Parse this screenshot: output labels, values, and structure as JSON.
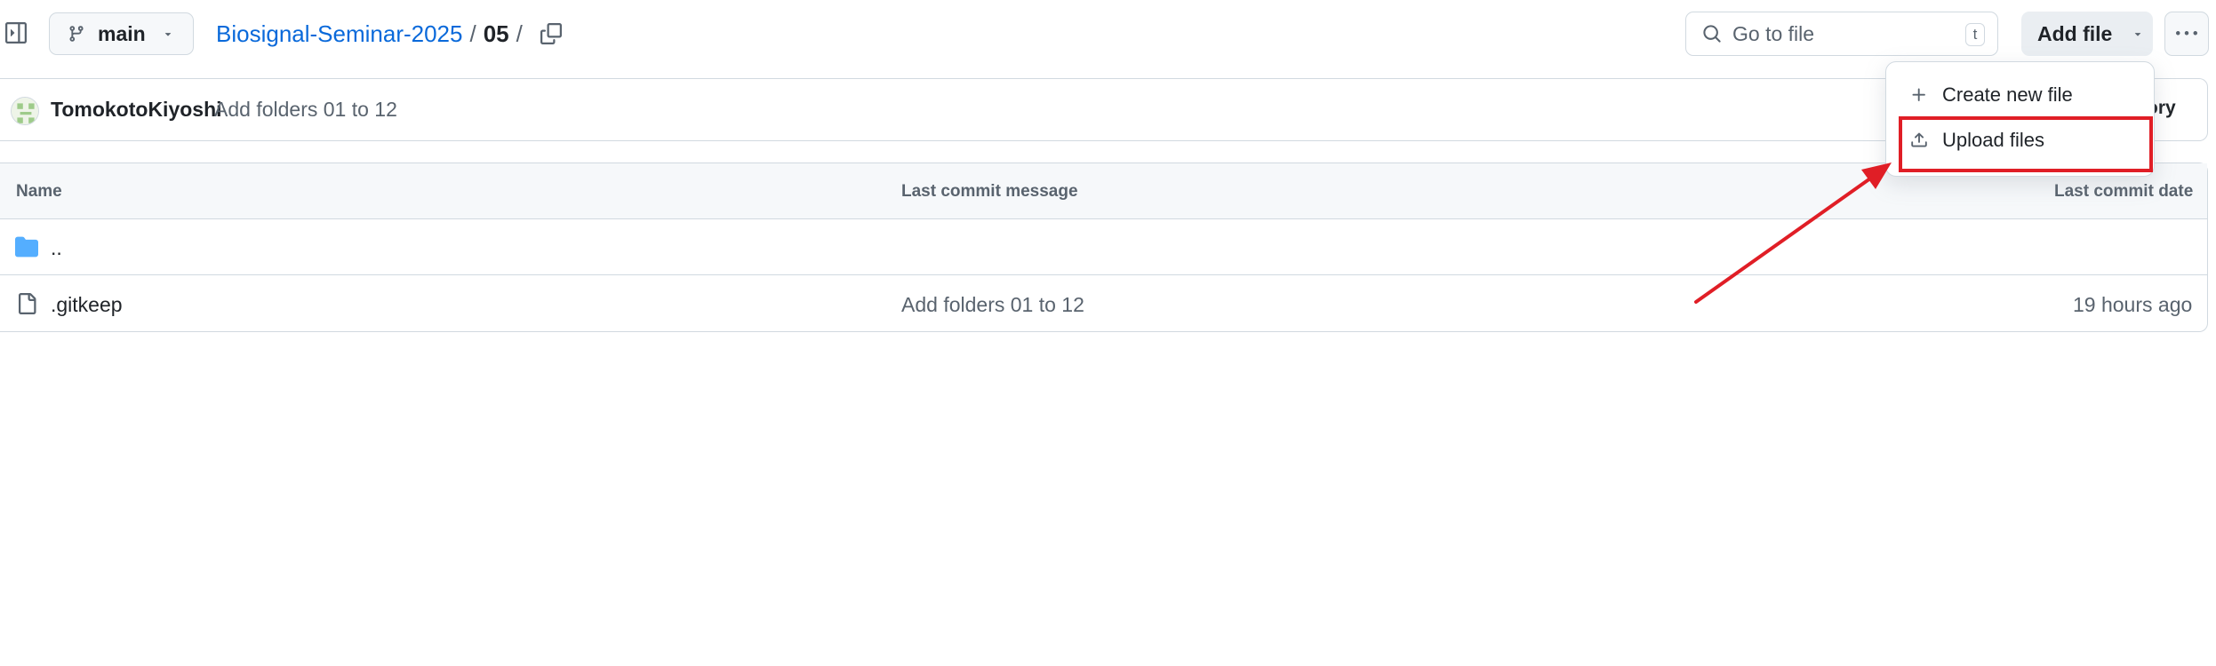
{
  "top_bar": {
    "branch": "main",
    "breadcrumb": {
      "repo": "Biosignal-Seminar-2025",
      "separator": "/",
      "folder": "05",
      "trailing_separator": "/"
    },
    "search_placeholder": "Go to file",
    "search_shortcut": "t",
    "add_file_label": "Add file"
  },
  "commit_bar": {
    "author": "TomokotoKiyoshi",
    "message": "Add folders 01 to 12",
    "history_label": "tory"
  },
  "file_table": {
    "columns": [
      "Name",
      "Last commit message",
      "Last commit date"
    ],
    "rows": [
      {
        "name": "..",
        "type": "folder",
        "message": "",
        "date": ""
      },
      {
        "name": ".gitkeep",
        "type": "file",
        "message": "Add folders 01 to 12",
        "date": "19 hours ago"
      }
    ]
  },
  "add_file_menu": {
    "items": [
      {
        "label": "Create new file",
        "icon": "plus-icon"
      },
      {
        "label": "Upload files",
        "icon": "upload-icon"
      }
    ]
  },
  "annotation": {
    "highlight_color": "#e01e26",
    "target": "Upload files"
  },
  "colors": {
    "link": "#0969da",
    "folder": "#54aeff",
    "border": "#d1d9e0",
    "muted_text": "#59636e"
  }
}
